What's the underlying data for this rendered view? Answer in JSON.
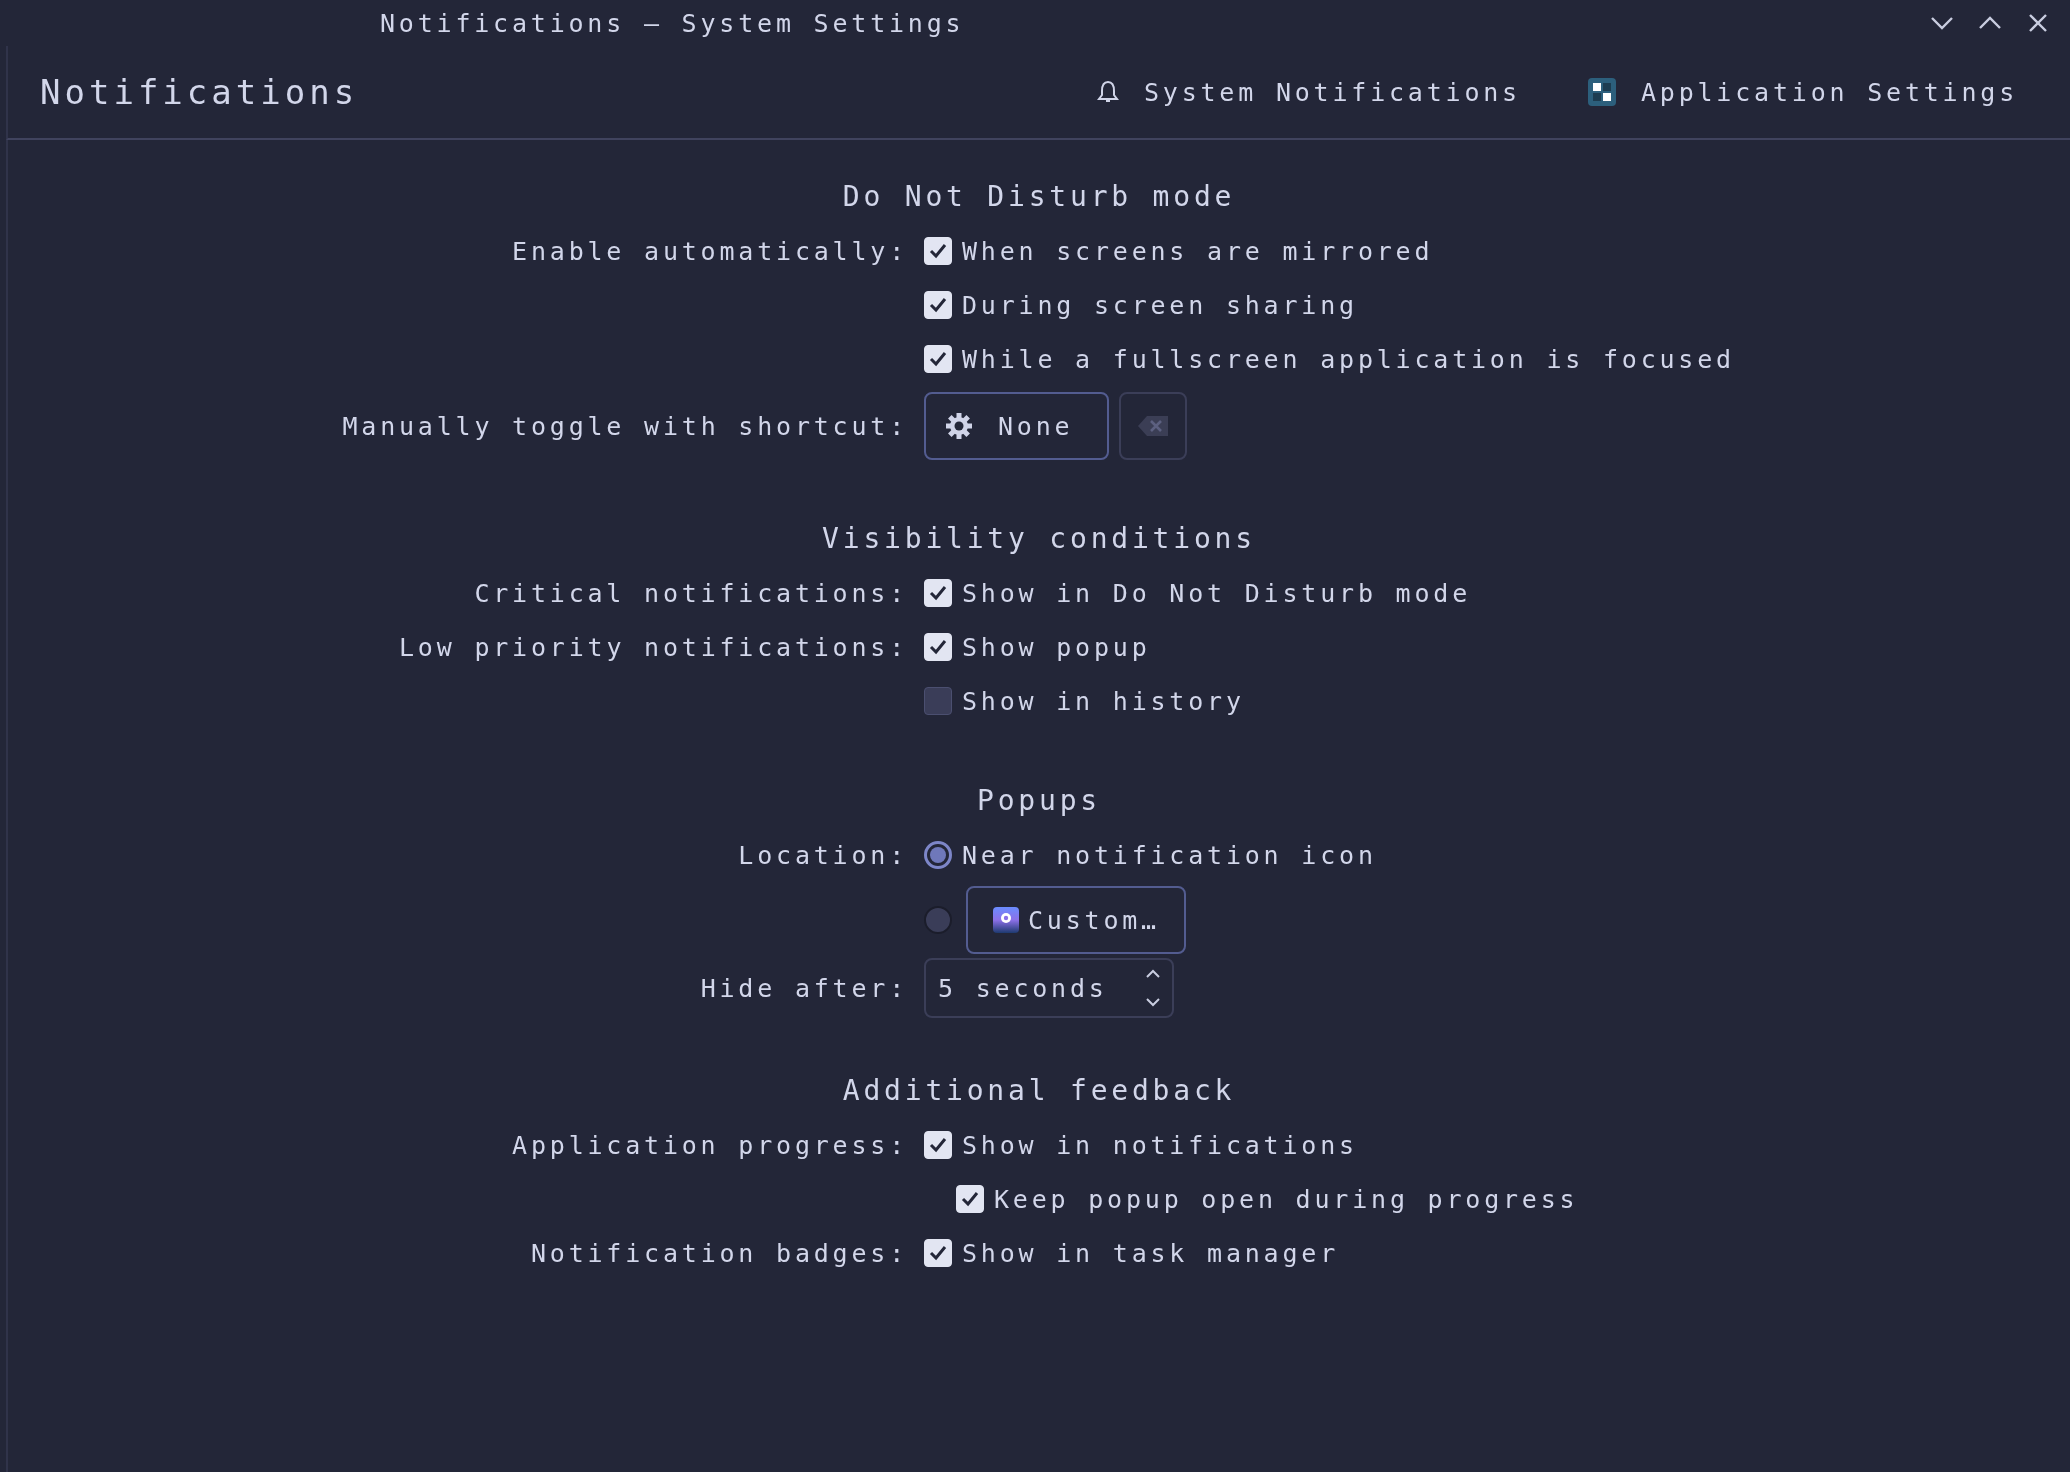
{
  "window": {
    "title": "Notifications — System Settings"
  },
  "header": {
    "title": "Notifications",
    "links": [
      {
        "label": "System Notifications",
        "kind": "bell"
      },
      {
        "label": "Application Settings",
        "kind": "apps"
      }
    ]
  },
  "sections": [
    {
      "title": "Do Not Disturb mode",
      "rows": [
        {
          "kind": "checkbox",
          "label": "Enable automatically:",
          "text": "When screens are mirrored",
          "checked": true
        },
        {
          "kind": "checkbox",
          "text": "During screen sharing",
          "checked": true
        },
        {
          "kind": "checkbox",
          "text": "While a fullscreen application is focused",
          "checked": true
        },
        {
          "kind": "shortcut",
          "label": "Manually toggle with shortcut:",
          "value": "None",
          "clear_disabled": true
        }
      ]
    },
    {
      "title": "Visibility conditions",
      "rows": [
        {
          "kind": "checkbox",
          "label": "Critical notifications:",
          "text": "Show in Do Not Disturb mode",
          "checked": true
        },
        {
          "kind": "checkbox",
          "label": "Low priority notifications:",
          "text": "Show popup",
          "checked": true
        },
        {
          "kind": "checkbox",
          "text": "Show in history",
          "checked": false
        }
      ]
    },
    {
      "title": "Popups",
      "rows": [
        {
          "kind": "radio",
          "label": "Location:",
          "text": "Near notification icon",
          "selected": true
        },
        {
          "kind": "radio-button",
          "button": "Custom…",
          "selected": false
        },
        {
          "kind": "spin",
          "label": "Hide after:",
          "value": "5 seconds"
        }
      ]
    },
    {
      "title": "Additional feedback",
      "rows": [
        {
          "kind": "checkbox",
          "label": "Application progress:",
          "text": "Show in notifications",
          "checked": true,
          "children": [
            {
              "kind": "checkbox",
              "text": "Keep popup open during progress",
              "checked": true
            }
          ]
        },
        {
          "kind": "checkbox",
          "label": "Notification badges:",
          "text": "Show in task manager",
          "checked": true
        }
      ]
    }
  ]
}
